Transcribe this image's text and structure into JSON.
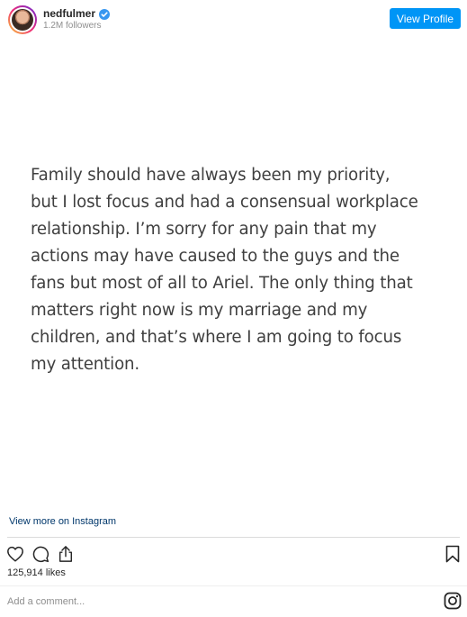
{
  "header": {
    "username": "nedfulmer",
    "followers": "1.2M followers",
    "view_profile_label": "View Profile",
    "verified_icon": "verified-badge-icon"
  },
  "post": {
    "statement_lines": [
      "Family should have always been my priority,",
      "but I lost focus and had a consensual workplace",
      "relationship.  I’m sorry for any pain that my",
      "actions may have caused to the guys and the",
      "fans but most of all to Ariel. The only thing that",
      "matters right now is my marriage and my",
      "children, and that’s where I am going to focus",
      "my attention."
    ],
    "view_more_label": "View more on Instagram",
    "likes": "125,914 likes",
    "comment_placeholder": "Add a comment..."
  },
  "icons": {
    "like": "heart-icon",
    "comment": "comment-icon",
    "share": "share-icon",
    "save": "bookmark-icon",
    "brand": "instagram-logo-icon"
  },
  "colors": {
    "accent": "#0095f6",
    "link": "#00376b",
    "text": "#262626",
    "muted": "#8e8e8e"
  }
}
